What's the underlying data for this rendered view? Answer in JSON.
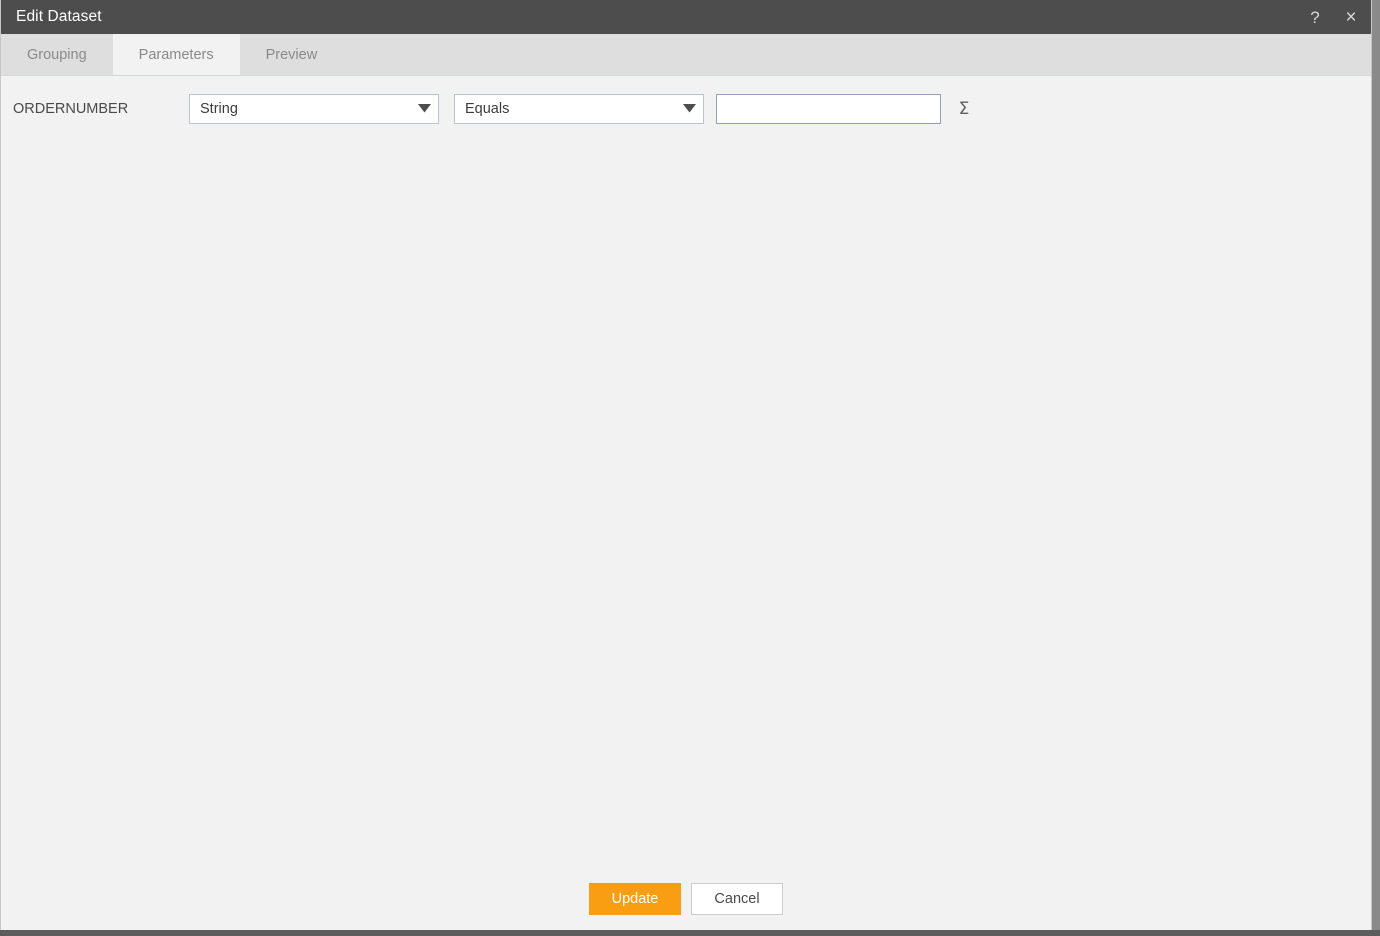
{
  "window": {
    "title": "Edit Dataset",
    "help_icon": "question-mark-icon",
    "help_label": "?",
    "close_icon": "close-icon",
    "close_label": "×"
  },
  "tabs": [
    {
      "label": "Grouping",
      "active": false
    },
    {
      "label": "Parameters",
      "active": true
    },
    {
      "label": "Preview",
      "active": false
    }
  ],
  "parameters": [
    {
      "name": "ORDERNUMBER",
      "type": {
        "selected": "String",
        "icon": "chevron-down-icon"
      },
      "operator": {
        "selected": "Equals",
        "icon": "chevron-down-icon"
      },
      "value": "",
      "value_placeholder": "",
      "aggregate_icon": "sigma-icon",
      "aggregate_label": "Σ"
    }
  ],
  "footer": {
    "update_label": "Update",
    "cancel_label": "Cancel"
  },
  "colors": {
    "titlebar_bg": "#4d4d4d",
    "tabbar_bg": "#dedede",
    "active_tab_bg": "#f2f2f2",
    "content_bg": "#f2f2f2",
    "accent": "#f99d12",
    "input_border": "#93a0bb",
    "select_border": "#b9c2d0",
    "label_text": "#4a4a4a",
    "tab_text": "#8a8a8a"
  }
}
